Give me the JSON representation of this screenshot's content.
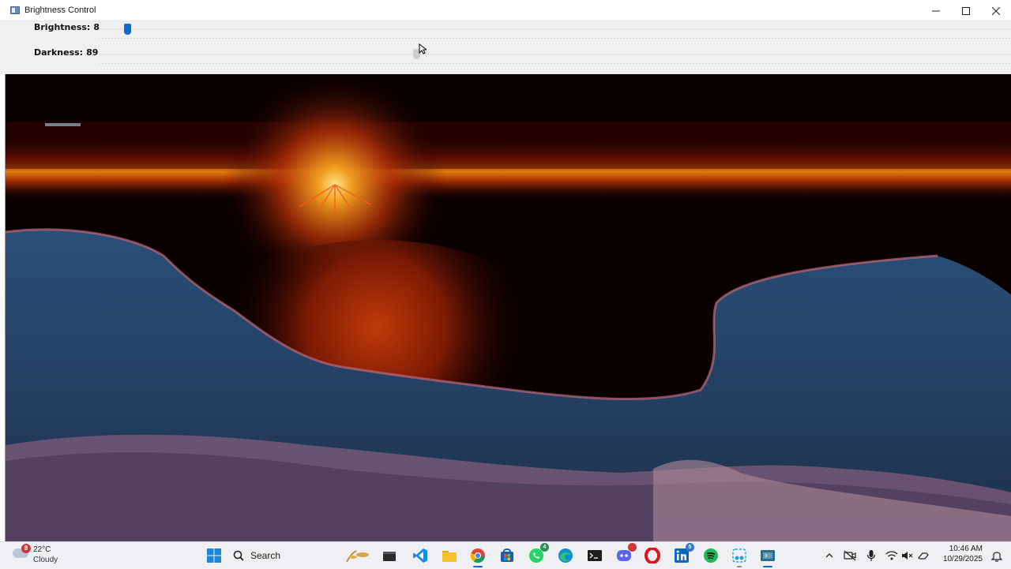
{
  "window": {
    "title": "Brightness Control",
    "controls": {
      "minimize": "—",
      "maximize": "☐",
      "close": "✕"
    }
  },
  "sliders": {
    "brightness": {
      "label": "Brightness:",
      "value": "8",
      "accent": "#0a6cd0"
    },
    "darkness": {
      "label": "Darkness:",
      "value": "89"
    }
  },
  "taskbar": {
    "weather": {
      "temp": "22°C",
      "desc": "Cloudy",
      "badge": "8"
    },
    "search": {
      "placeholder": "Search"
    },
    "apps": [
      {
        "name": "windows-start-icon"
      },
      {
        "name": "widgets-icon"
      },
      {
        "name": "terminal-app-icon"
      },
      {
        "name": "vscode-icon"
      },
      {
        "name": "file-explorer-icon"
      },
      {
        "name": "chrome-icon"
      },
      {
        "name": "store-icon"
      },
      {
        "name": "whatsapp-icon",
        "badge": "4"
      },
      {
        "name": "edge-icon"
      },
      {
        "name": "command-prompt-icon"
      },
      {
        "name": "discord-icon"
      },
      {
        "name": "opera-icon"
      },
      {
        "name": "linkedin-icon",
        "badge": "5"
      },
      {
        "name": "spotify-icon"
      },
      {
        "name": "snipping-tool-icon"
      },
      {
        "name": "python-app-icon"
      }
    ],
    "clock": {
      "time": "10:46 AM",
      "date": "10/29/2025"
    }
  }
}
